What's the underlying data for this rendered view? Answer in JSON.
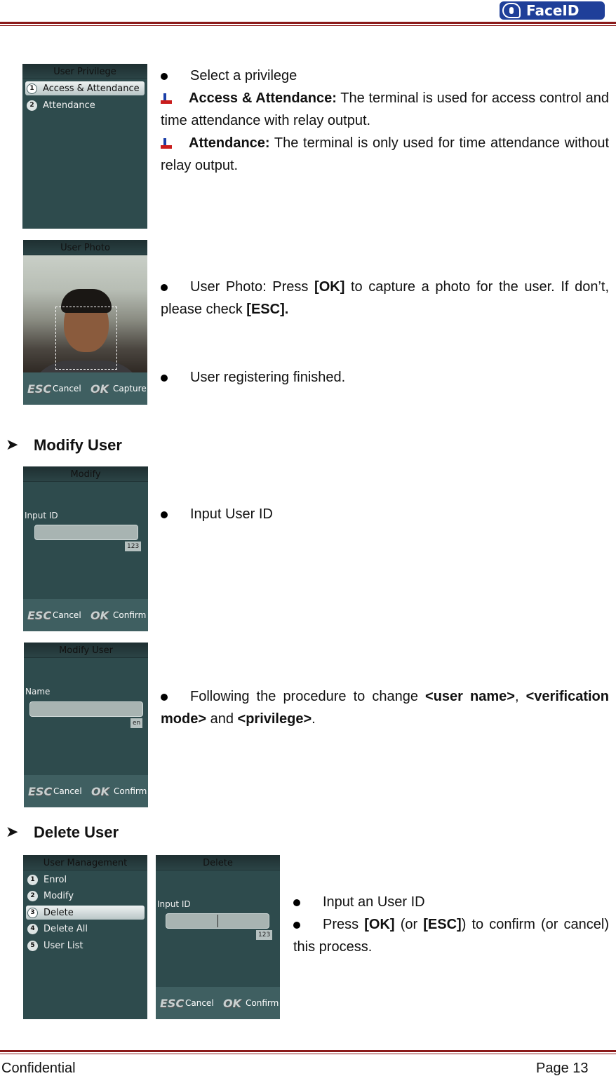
{
  "header": {
    "logo_text": "FaceID"
  },
  "footer": {
    "left": "Confidential",
    "right": "Page 13"
  },
  "screens": {
    "privilege": {
      "title": "User Privilege",
      "items": [
        {
          "num": "1",
          "label": "Access & Attendance"
        },
        {
          "num": "2",
          "label": "Attendance"
        }
      ]
    },
    "photo": {
      "title": "User Photo",
      "esc": "ESC",
      "cancel": "Cancel",
      "ok": "OK",
      "action": "Capture"
    },
    "modify": {
      "title": "Modify",
      "label": "Input ID",
      "ime": "123",
      "esc": "ESC",
      "cancel": "Cancel",
      "ok": "OK",
      "action": "Confirm"
    },
    "modify_user": {
      "title": "Modify User",
      "label": "Name",
      "ime": "en",
      "esc": "ESC",
      "cancel": "Cancel",
      "ok": "OK",
      "action": "Confirm"
    },
    "user_mgmt": {
      "title": "User Management",
      "items": [
        {
          "num": "1",
          "label": "Enrol"
        },
        {
          "num": "2",
          "label": "Modify"
        },
        {
          "num": "3",
          "label": "Delete"
        },
        {
          "num": "4",
          "label": "Delete All"
        },
        {
          "num": "5",
          "label": "User List"
        }
      ]
    },
    "delete": {
      "title": "Delete",
      "label": "Input ID",
      "ime": "123",
      "esc": "ESC",
      "cancel": "Cancel",
      "ok": "OK",
      "action": "Confirm"
    }
  },
  "text": {
    "select_privilege": "Select a privilege",
    "aa_title": "Access & Attendance:",
    "aa_desc": " The terminal is used for access control and time attendance with relay output.",
    "att_title": "Attendance:",
    "att_desc": " The terminal is only used for time attendance without relay output.",
    "photo_a": "User Photo: Press ",
    "photo_ok": "[OK]",
    "photo_b": " to capture a photo for the user. If don’t, please check ",
    "photo_esc": "[ESC].",
    "finished": "User registering finished.",
    "modify_heading": "Modify User",
    "input_user_id": "Input User ID",
    "follow_a": "Following the procedure to change ",
    "follow_name": "<user name>",
    "follow_b": ", ",
    "follow_mode": "<verification mode>",
    "follow_c": " and ",
    "follow_priv": "<privilege>",
    "follow_d": ".",
    "delete_heading": "Delete User",
    "input_an_id": "Input an User ID",
    "press_a": "Press ",
    "press_ok": "[OK]",
    "press_b": " (or ",
    "press_esc": "[ESC]",
    "press_c": ") to confirm (or cancel) this process."
  }
}
